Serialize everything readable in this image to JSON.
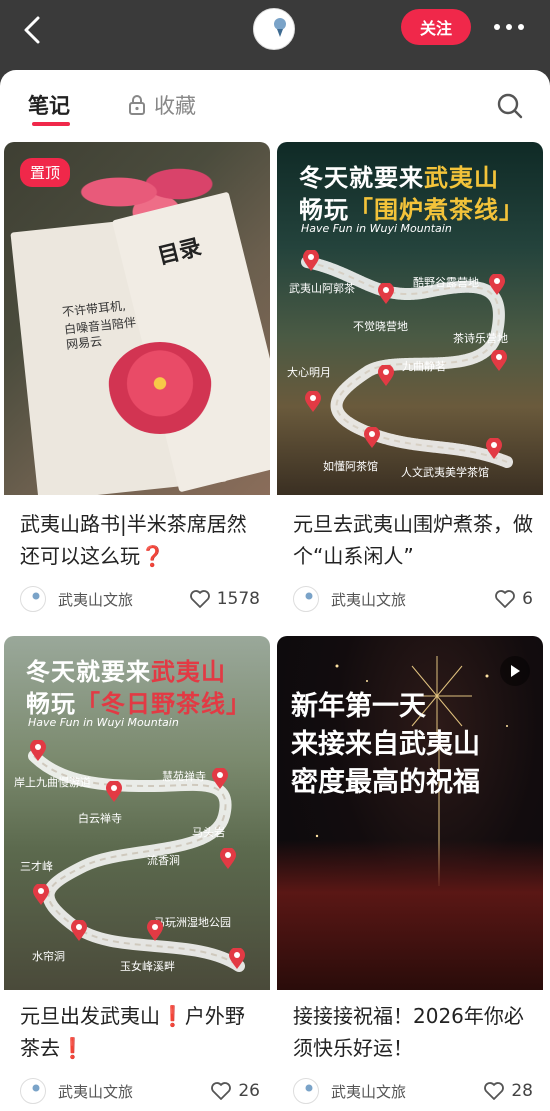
{
  "header": {
    "avatar_text": "武夷山文旅",
    "follow_label": "关注"
  },
  "tabs": {
    "notes_label": "笔记",
    "favorites_label": "收藏"
  },
  "cards": [
    {
      "badge": "置顶",
      "title": "武夷山路书|半米茶席居然还可以这么玩❓",
      "author": "武夷山文旅",
      "likes": "1578",
      "cover_text": {
        "catalog": "目录",
        "line1": "不许带耳机,",
        "line2": "白噪音当陪伴",
        "line3": "网易云"
      }
    },
    {
      "title": "元旦去武夷山围炉煮茶，做个“山系闲人”",
      "author": "武夷山文旅",
      "likes": "6",
      "cover_text": {
        "title_line1_a": "冬天就要来",
        "title_line1_b": "武夷山",
        "title_line2_a": "畅玩",
        "title_line2_b": "「围炉煮茶线」",
        "subtitle": "Have Fun in Wuyi Mountain",
        "pois": [
          "武夷山阿郭茶",
          "酷野谷露营地",
          "不觉晓营地",
          "茶诗乐营地",
          "九曲静茗",
          "大心明月",
          "如懂阿茶馆",
          "人文武夷美学茶馆"
        ]
      }
    },
    {
      "title": "元旦出发武夷山❗户外野茶去❗",
      "author": "武夷山文旅",
      "likes": "26",
      "cover_text": {
        "title_line1_a": "冬天就要来",
        "title_line1_b": "武夷山",
        "title_line2_a": "畅玩",
        "title_line2_b": "「冬日野茶线」",
        "subtitle": "Have Fun in Wuyi Mountain",
        "pois": [
          "岸上九曲慢游道",
          "慧苑禅寺",
          "白云禅寺",
          "马头岩",
          "流香涧",
          "三才峰",
          "马玩洲湿地公园",
          "水帘洞",
          "玉女峰溪畔"
        ]
      }
    },
    {
      "title": "接接接祝福！2026年你必须快乐好运！",
      "author": "武夷山文旅",
      "likes": "28",
      "cover_text": {
        "line1": "新年第一天",
        "line2": "来接来自武夷山",
        "line3": "密度最高的祝福"
      }
    }
  ],
  "colors": {
    "accent": "#f0284a",
    "highlight": "#f3c33a",
    "header_bg": "#3a3a3a"
  },
  "icons": [
    "back-arrow-icon",
    "more-dots-icon",
    "lock-icon",
    "search-icon",
    "heart-icon",
    "play-icon",
    "map-pin-icon"
  ]
}
